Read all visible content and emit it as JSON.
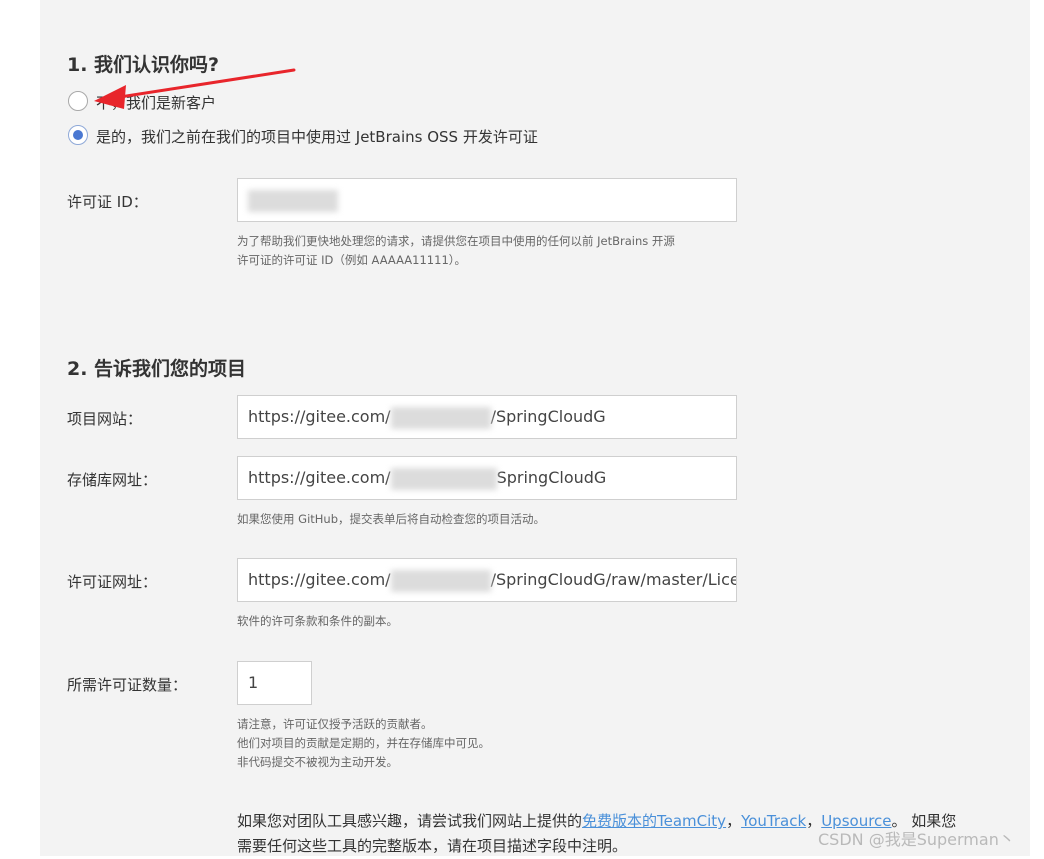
{
  "section1": {
    "title": "1. 我们认识你吗?",
    "options": [
      {
        "label": "不，我们是新客户",
        "checked": false
      },
      {
        "label": "是的，我们之前在我们的项目中使用过 JetBrains OSS 开发许可证",
        "checked": true
      }
    ],
    "license_id": {
      "label": "许可证 ID：",
      "help_line1": "为了帮助我们更快地处理您的请求，请提供您在项目中使用的任何以前 JetBrains 开源",
      "help_line2": "许可证的许可证 ID（例如 AAAAA11111）。"
    }
  },
  "section2": {
    "title": "2. 告诉我们您的项目",
    "website": {
      "label": "项目网站：",
      "value_prefix": "https://gitee.com/",
      "value_suffix": "/SpringCloudG"
    },
    "repository": {
      "label": "存储库网址：",
      "value_prefix": "https://gitee.com/",
      "value_suffix": "SpringCloudG",
      "help": "如果您使用 GitHub，提交表单后将自动检查您的项目活动。"
    },
    "license_url": {
      "label": "许可证网址：",
      "value_prefix": "https://gitee.com/",
      "value_suffix": "/SpringCloudG/raw/master/Licen",
      "help": "软件的许可条款和条件的副本。"
    },
    "license_count": {
      "label": "所需许可证数量：",
      "value": "1",
      "help_lines": [
        "请注意，许可证仅授予活跃的贡献者。",
        "他们对项目的贡献是定期的，并在存储库中可见。",
        "非代码提交不被视为主动开发。"
      ]
    },
    "promo": {
      "line1_text": "如果您对团队工具感兴趣，请尝试我们网站上提供的",
      "link1": "免费版本的TeamCity",
      "sep1": "，",
      "link2": "YouTrack",
      "sep2": "，",
      "link3": "Upsource",
      "line1_end": "。 如果您",
      "line2": "需要任何这些工具的完整版本，请在项目描述字段中注明。"
    }
  },
  "watermark": "CSDN @我是Superman丶",
  "colors": {
    "accent": "#4a78d2",
    "link": "#4a90d9",
    "arrow": "#e8252b",
    "panel": "#f3f3f3"
  }
}
